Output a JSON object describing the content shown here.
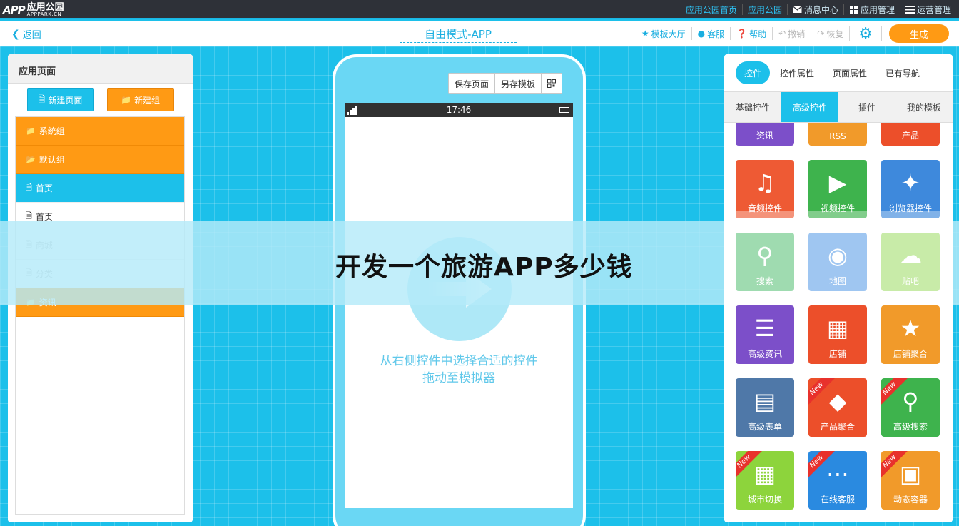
{
  "topbar": {
    "logo_mark": "APP",
    "logo_name": "应用公园",
    "logo_domain": "APPPARK.CN",
    "links": [
      "应用公园首页",
      "应用公园",
      "消息中心",
      "应用管理",
      "运营管理"
    ]
  },
  "subbar": {
    "back_label": "返回",
    "title": "自由模式-APP",
    "tools": {
      "templates": "模板大厅",
      "service": "客服",
      "help": "帮助",
      "undo": "撤销",
      "redo": "恢复"
    },
    "generate": "生成"
  },
  "left_panel": {
    "title": "应用页面",
    "new_page": "新建页面",
    "new_group": "新建组",
    "items": [
      {
        "label": "系统组",
        "type": "folder",
        "state": "orange"
      },
      {
        "label": "默认组",
        "type": "folder-open",
        "state": "orange"
      },
      {
        "label": "首页",
        "type": "page",
        "state": "selected"
      },
      {
        "label": "首页",
        "type": "page",
        "state": "normal"
      },
      {
        "label": "商城",
        "type": "page",
        "state": "disabled"
      },
      {
        "label": "分类",
        "type": "page",
        "state": "disabled"
      },
      {
        "label": "资讯",
        "type": "folder",
        "state": "orange"
      }
    ]
  },
  "phone": {
    "save_page": "保存页面",
    "save_template": "另存模板",
    "qr_icon": "qr-code-icon",
    "time": "17:46",
    "hint_line1": "从右侧控件中选择合适的控件",
    "hint_line2": "拖动至模拟器"
  },
  "banner": {
    "text": "开发一个旅游APP多少钱"
  },
  "right_panel": {
    "tabs": [
      "控件",
      "控件属性",
      "页面属性",
      "已有导航"
    ],
    "subtabs": [
      "基础控件",
      "高级控件",
      "插件",
      "我的模板"
    ],
    "tiles": [
      {
        "label": "资讯",
        "color": "#7c4fc9",
        "icon": "list-icon",
        "new": false
      },
      {
        "label": "RSS",
        "color": "#f19a2a",
        "icon": "rss-icon",
        "new": false
      },
      {
        "label": "产品",
        "color": "#ec4f2a",
        "icon": "product-icon",
        "new": false
      },
      {
        "label": "音频控件",
        "color": "#ee5a34",
        "icon": "music-icon",
        "new": false
      },
      {
        "label": "视频控件",
        "color": "#3eb34d",
        "icon": "play-icon",
        "new": false
      },
      {
        "label": "浏览器控件",
        "color": "#3e89dc",
        "icon": "compass-icon",
        "new": false
      },
      {
        "label": "搜索",
        "color": "#9fdbb0",
        "icon": "search-icon",
        "new": false
      },
      {
        "label": "地图",
        "color": "#9fc6f1",
        "icon": "map-pin-icon",
        "new": false
      },
      {
        "label": "贴吧",
        "color": "#c8eba8",
        "icon": "chat-icon",
        "new": false
      },
      {
        "label": "高级资讯",
        "color": "#7c4fc9",
        "icon": "pro-list-icon",
        "new": false
      },
      {
        "label": "店铺",
        "color": "#ec4f2a",
        "icon": "store-icon",
        "new": false
      },
      {
        "label": "店铺聚合",
        "color": "#f19a2a",
        "icon": "mall-icon",
        "new": false
      },
      {
        "label": "高级表单",
        "color": "#4f78a8",
        "icon": "form-icon",
        "new": false
      },
      {
        "label": "产品聚合",
        "color": "#ec4f2a",
        "icon": "grid-icon",
        "new": true
      },
      {
        "label": "高级搜索",
        "color": "#3eb34d",
        "icon": "zoom-icon",
        "new": true
      },
      {
        "label": "城市切换",
        "color": "#8dd43c",
        "icon": "city-icon",
        "new": true
      },
      {
        "label": "在线客服",
        "color": "#2a8ae0",
        "icon": "chat-bubble-icon",
        "new": true
      },
      {
        "label": "动态容器",
        "color": "#f19a2a",
        "icon": "box-icon",
        "new": true
      }
    ],
    "new_badge": "New"
  }
}
